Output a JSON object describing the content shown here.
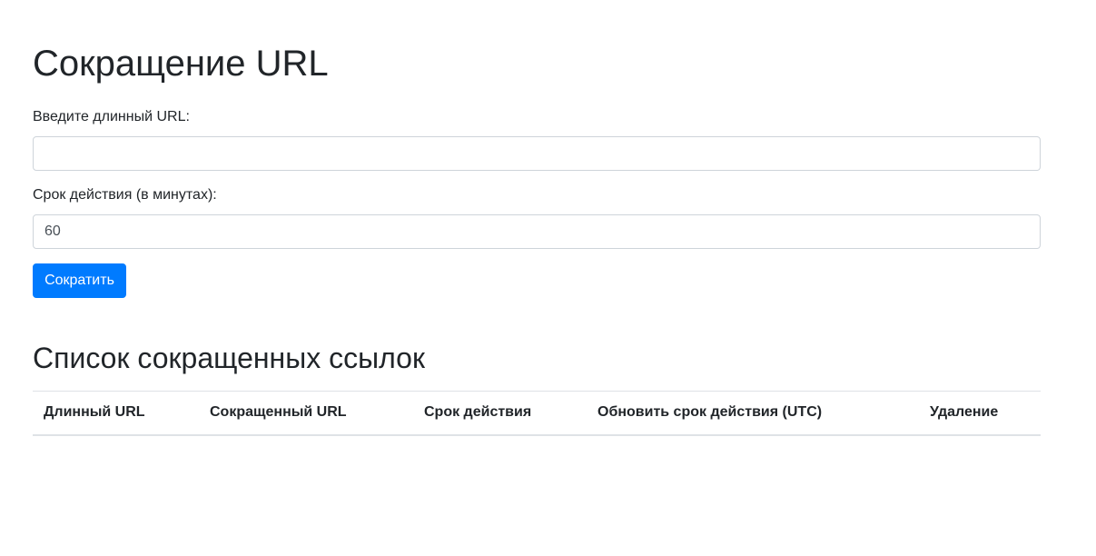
{
  "page": {
    "title": "Сокращение URL"
  },
  "form": {
    "url_label": "Введите длинный URL:",
    "url_value": "",
    "expiration_label": "Срок действия (в минутах):",
    "expiration_value": "60",
    "submit_label": "Сократить"
  },
  "list": {
    "title": "Список сокращенных ссылок",
    "columns": [
      "Длинный URL",
      "Сокращенный URL",
      "Срок действия",
      "Обновить срок действия (UTC)",
      "Удаление"
    ],
    "rows": []
  },
  "colors": {
    "primary": "#007bff",
    "text": "#212529",
    "border": "#ced4da"
  }
}
